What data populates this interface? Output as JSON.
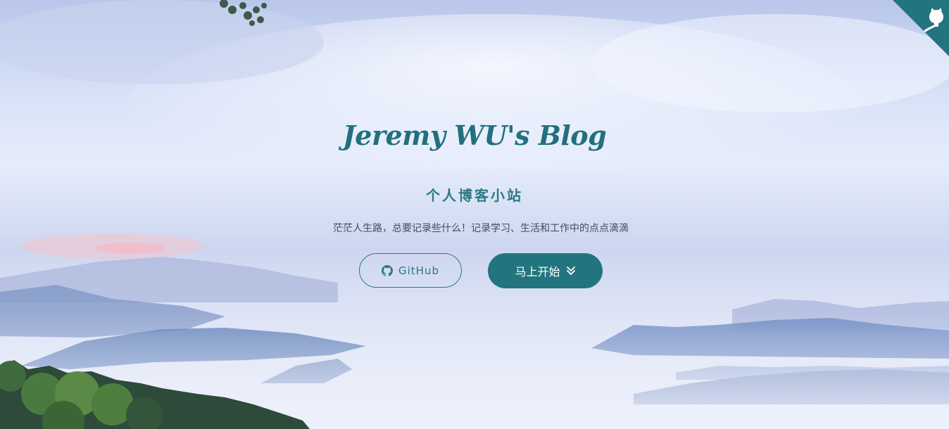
{
  "site": {
    "title": "Jeremy WU's Blog",
    "subtitle": "个人博客小站",
    "tagline": "茫茫人生路，总要记录些什么！记录学习、生活和工作中的点点滴滴"
  },
  "buttons": {
    "github_label": "GitHub",
    "github_icon": "github-icon",
    "start_label": "马上开始",
    "start_icon": "double-chevron-down-icon"
  },
  "corner": {
    "icon": "github-octocat-icon"
  },
  "colors": {
    "accent": "#22757f",
    "title": "#22707e",
    "tagline": "#3c4d63"
  }
}
